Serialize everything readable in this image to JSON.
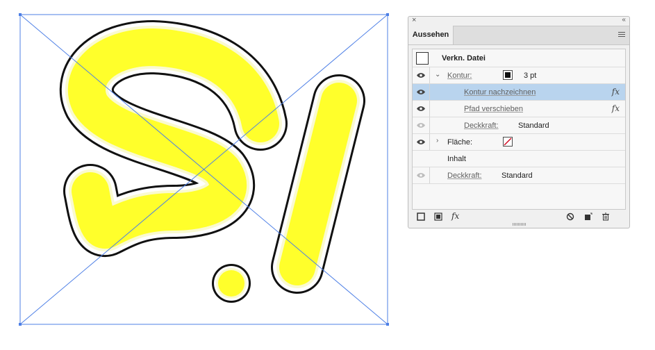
{
  "panel": {
    "close_glyph": "×",
    "collapse_glyph": "‹‹",
    "tab_label": "Aussehen",
    "menu_icon": "panel-menu-icon"
  },
  "rows": {
    "header_label": "Verkn. Datei",
    "stroke_label": "Kontur:",
    "stroke_weight": "3 pt",
    "stroke_effect_1": "Kontur nachzeichnen",
    "stroke_effect_2": "Pfad verschieben",
    "stroke_opacity_label": "Deckkraft:",
    "stroke_opacity_value": "Standard",
    "fill_label": "Fläche:",
    "content_label": "Inhalt",
    "opacity_label": "Deckkraft:",
    "opacity_value": "Standard",
    "fx_glyph": "fx"
  },
  "colors": {
    "artwork_fill": "#ffff2b",
    "artwork_halo": "#fafad0",
    "bounding_box": "#4d7fe6",
    "selection_row": "#b9d4ee"
  },
  "icons": [
    "eye-icon",
    "chevron-down-icon",
    "chevron-right-icon",
    "fx-icon",
    "add-stroke-icon",
    "add-fill-icon",
    "add-effect-icon",
    "clear-appearance-icon",
    "duplicate-item-icon",
    "delete-item-icon"
  ]
}
